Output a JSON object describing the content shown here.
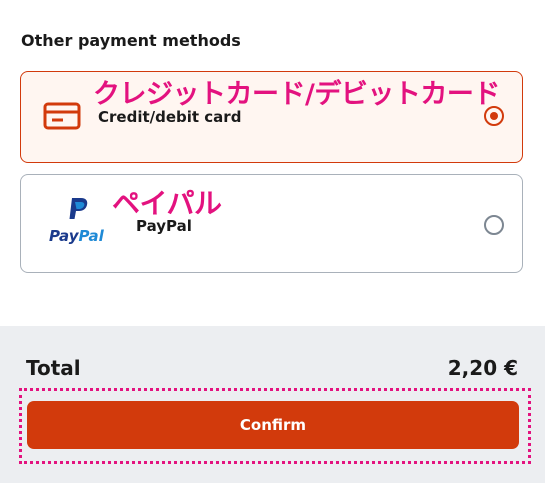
{
  "section": {
    "title": "Other payment methods"
  },
  "methods": [
    {
      "label": "Credit/debit card",
      "icon": "credit-card-icon",
      "selected": true,
      "annotation": "クレジットカード/デビットカード"
    },
    {
      "label": "PayPal",
      "icon": "paypal-logo",
      "logo_text_1": "Pay",
      "logo_text_2": "Pal",
      "selected": false,
      "annotation": "ペイパル"
    }
  ],
  "summary": {
    "total_label": "Total",
    "total_value": "2,20 €"
  },
  "actions": {
    "confirm_label": "Confirm"
  },
  "colors": {
    "accent": "#d23a0c",
    "annotation": "#e3127f",
    "panel": "#eceef1"
  }
}
